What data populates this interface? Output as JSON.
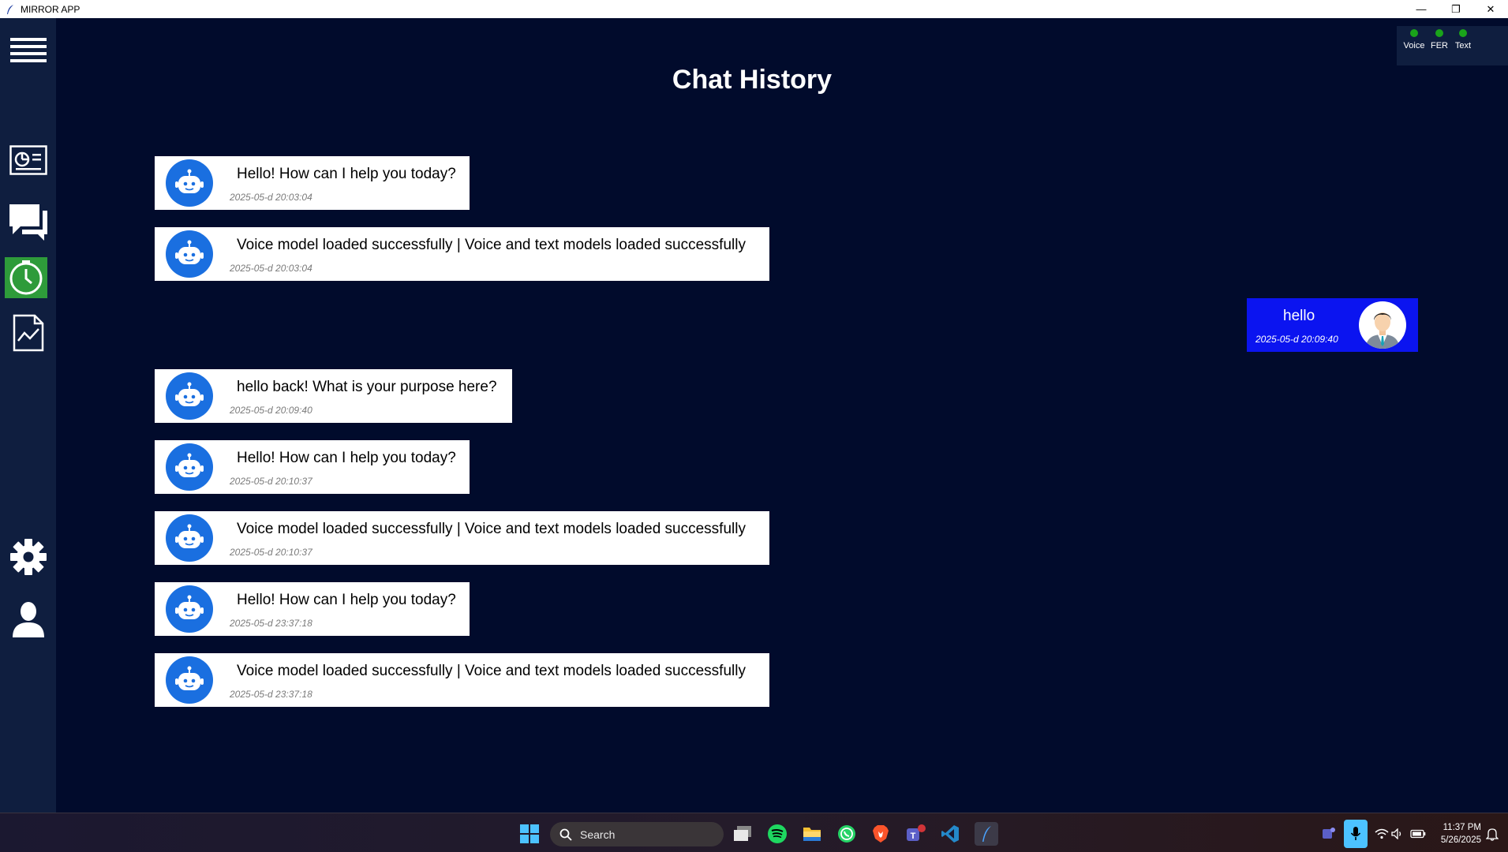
{
  "window": {
    "title": "MIRROR APP"
  },
  "main": {
    "title": "Chat History"
  },
  "status": [
    {
      "label": "Voice",
      "color": "#1aa41a"
    },
    {
      "label": "FER",
      "color": "#1aa41a"
    },
    {
      "label": "Text",
      "color": "#1aa41a"
    }
  ],
  "sidebar": {
    "items": [
      {
        "name": "menu-icon"
      },
      {
        "name": "dashboard-icon"
      },
      {
        "name": "chat-icon"
      },
      {
        "name": "history-icon",
        "active": true
      },
      {
        "name": "report-icon"
      },
      {
        "name": "settings-icon"
      },
      {
        "name": "user-icon"
      }
    ]
  },
  "messages": [
    {
      "sender": "bot",
      "text": "Hello! How can I help you today?",
      "time": "2025-05-d 20:03:04"
    },
    {
      "sender": "bot",
      "text": "Voice model loaded successfully | Voice and text models loaded successfully",
      "time": "2025-05-d 20:03:04"
    },
    {
      "sender": "user",
      "text": "hello",
      "time": "2025-05-d 20:09:40"
    },
    {
      "sender": "bot",
      "text": "hello back! What is your purpose here?",
      "time": "2025-05-d 20:09:40"
    },
    {
      "sender": "bot",
      "text": "Hello! How can I help you today?",
      "time": "2025-05-d 20:10:37"
    },
    {
      "sender": "bot",
      "text": "Voice model loaded successfully | Voice and text models loaded successfully",
      "time": "2025-05-d 20:10:37"
    },
    {
      "sender": "bot",
      "text": "Hello! How can I help you today?",
      "time": "2025-05-d 23:37:18"
    },
    {
      "sender": "bot",
      "text": "Voice model loaded successfully | Voice and text models loaded successfully",
      "time": "2025-05-d 23:37:18"
    }
  ],
  "taskbar": {
    "search_label": "Search",
    "time": "11:37 PM",
    "date": "5/26/2025",
    "apps": [
      "start-icon",
      "task-view-icon",
      "spotify-icon",
      "file-explorer-icon",
      "whatsapp-icon",
      "brave-icon",
      "teams-icon",
      "vscode-icon",
      "mirror-app-icon"
    ]
  }
}
